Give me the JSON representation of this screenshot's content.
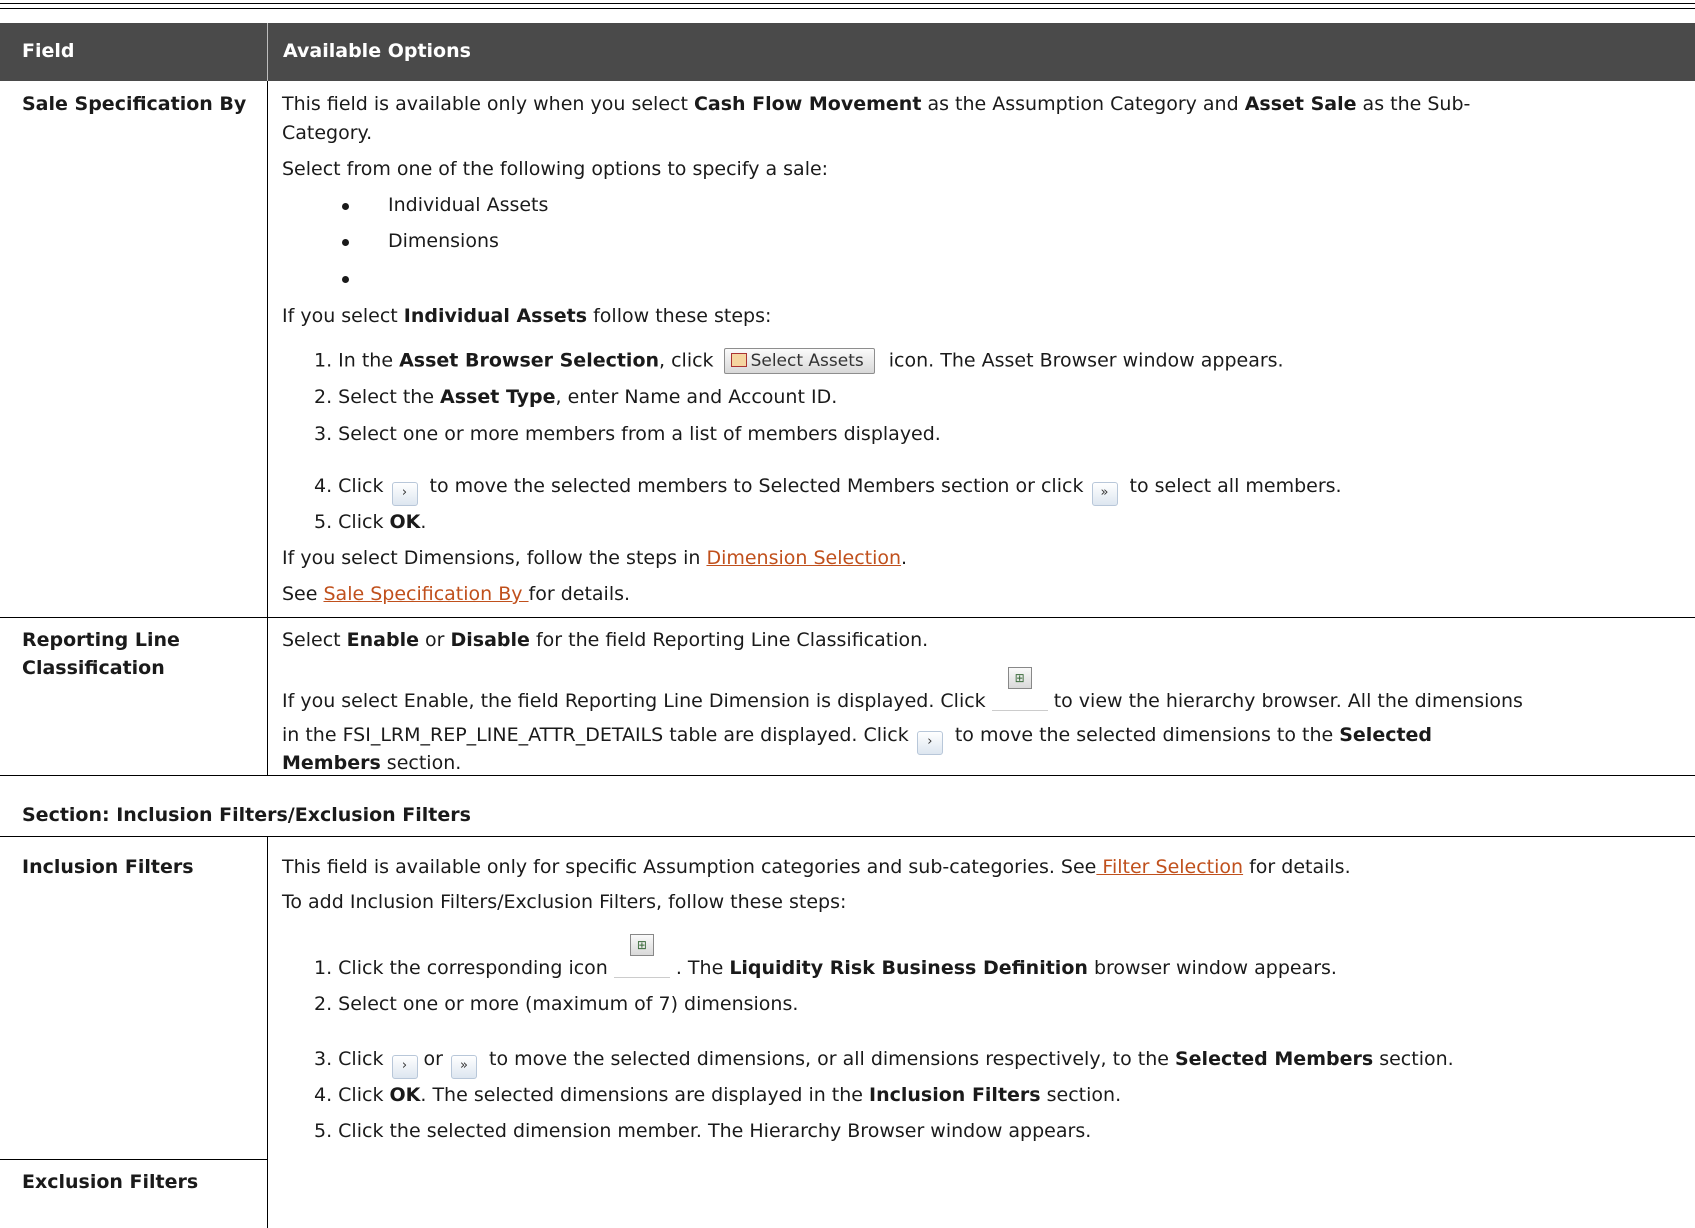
{
  "table": {
    "headers": {
      "field": "Field",
      "options": "Available Options"
    }
  },
  "sale_spec": {
    "field": "Sale Specification By",
    "line1_a": "This field is available only when you select ",
    "line1_b": "Cash Flow Movement",
    "line1_c": " as the Assumption Category and ",
    "line1_d": "Asset Sale",
    "line1_e": " as the Sub-",
    "line2": "Category.",
    "select_intro": "Select from one of the following options to specify a sale:",
    "bullets": [
      "Individual Assets",
      "Dimensions"
    ],
    "ifsel_a": "If you select ",
    "ifsel_b": "Individual Assets",
    "ifsel_c": " follow these steps:",
    "step1_a": "1.  In the ",
    "step1_b": "Asset Browser Selection",
    "step1_c": ", click",
    "select_assets_btn": "Select Assets",
    "step1_d": "icon. The Asset Browser window appears.",
    "step2_a": "2.  Select the ",
    "step2_b": "Asset Type",
    "step2_c": ", enter Name and Account ID.",
    "step3": "3.  Select one or more members from a list of members displayed.",
    "step4_a": "4.  Click",
    "step4_b": "to move the selected members to Selected Members section or click",
    "step4_c": "to select all members.",
    "step5_a": "5.  Click ",
    "step5_b": "OK",
    "step5_c": ".",
    "dim_a": "If you select Dimensions, follow the steps in ",
    "dim_link": "Dimension Selection",
    "dim_c": ".",
    "see_a": "See ",
    "see_link": "Sale Specification By ",
    "see_c": "for details."
  },
  "reporting": {
    "field_1": "Reporting Line",
    "field_2": "Classification",
    "l1_a": "Select ",
    "l1_b": "Enable",
    "l1_c": " or ",
    "l1_d": "Disable",
    "l1_e": " for the field Reporting Line Classification.",
    "l2_a": "If you select Enable, the field Reporting Line Dimension is displayed. Click",
    "l2_b": "to view the hierarchy browser. All the dimensions",
    "l3_a": "in the FSI_LRM_REP_LINE_ATTR_DETAILS table are displayed. Click",
    "l3_b": "to move the selected dimensions to the ",
    "l3_c": "Selected",
    "l4": "Members",
    "l4_b": " section."
  },
  "section_title": "Section: Inclusion Filters/Exclusion Filters",
  "filters": {
    "inclusion_field": "Inclusion Filters",
    "exclusion_field": "Exclusion Filters",
    "l1_a": "This field is available only for specific Assumption categories and sub-categories. See",
    "l1_link": " Filter Selection",
    "l1_c": " for details.",
    "l2": "To add Inclusion Filters/Exclusion Filters, follow these steps:",
    "s1_a": "1.  Click the corresponding icon",
    "s1_b": ". The ",
    "s1_c": "Liquidity Risk Business Definition",
    "s1_d": " browser window appears.",
    "s2": "2.  Select one or more  (maximum of 7) dimensions.",
    "s3_a": "3.  Click",
    "s3_or": "or",
    "s3_b": "to move the selected dimensions, or all dimensions respectively, to the ",
    "s3_c": "Selected Members",
    "s3_d": " section.",
    "s4_a": "4.  Click ",
    "s4_b": "OK",
    "s4_c": ". The selected dimensions are displayed in the ",
    "s4_d": "Inclusion Filters",
    "s4_e": " section.",
    "s5": "5.  Click the selected dimension member. The Hierarchy Browser window appears."
  },
  "icons": {
    "single_arrow": "›",
    "double_arrow": "»",
    "hierarchy": "⊞"
  }
}
